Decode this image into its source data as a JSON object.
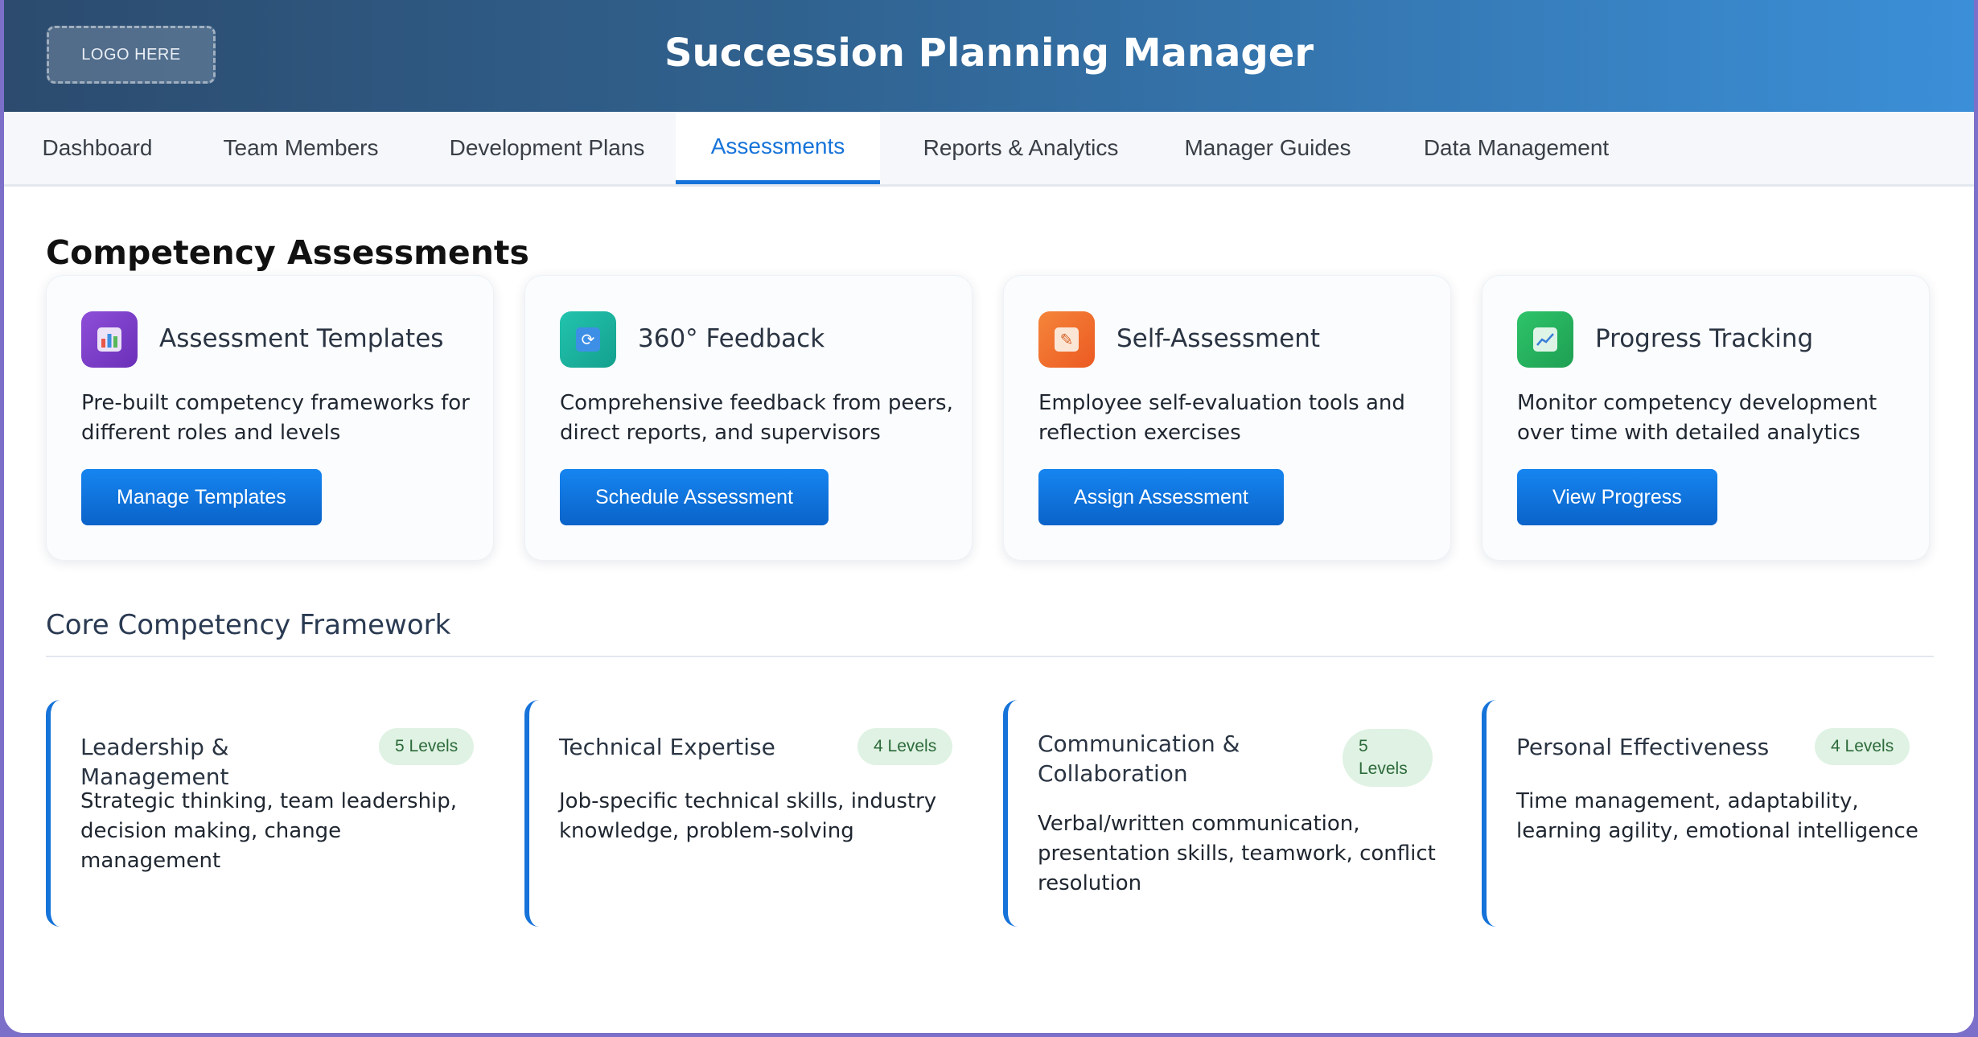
{
  "header": {
    "logo_text": "LOGO HERE",
    "title": "Succession Planning Manager"
  },
  "nav": {
    "tabs": [
      {
        "label": "Dashboard",
        "active": false
      },
      {
        "label": "Team Members",
        "active": false
      },
      {
        "label": "Development Plans",
        "active": false
      },
      {
        "label": "Assessments",
        "active": true
      },
      {
        "label": "Reports & Analytics",
        "active": false
      },
      {
        "label": "Manager Guides",
        "active": false
      },
      {
        "label": "Data Management",
        "active": false
      }
    ]
  },
  "main": {
    "title": "Competency Assessments",
    "cards": [
      {
        "icon": "bar-chart-icon",
        "icon_color": "#7b3fc4",
        "title": "Assessment Templates",
        "description": "Pre-built competency frameworks for different roles and levels",
        "button": "Manage Templates"
      },
      {
        "icon": "refresh-icon",
        "icon_color": "#1bb3a0",
        "title": "360° Feedback",
        "description": "Comprehensive feedback from peers, direct reports, and supervisors",
        "button": "Schedule Assessment"
      },
      {
        "icon": "memo-icon",
        "icon_color": "#f26b2a",
        "title": "Self-Assessment",
        "description": "Employee self-evaluation tools and reflection exercises",
        "button": "Assign Assessment"
      },
      {
        "icon": "trend-chart-icon",
        "icon_color": "#24b35c",
        "title": "Progress Tracking",
        "description": "Monitor competency development over time with detailed analytics",
        "button": "View Progress"
      }
    ],
    "framework": {
      "title": "Core Competency Framework",
      "items": [
        {
          "title": "Leadership & Management",
          "badge": "5 Levels",
          "description": "Strategic thinking, team leadership, decision making, change management"
        },
        {
          "title": "Technical Expertise",
          "badge": "4 Levels",
          "description": "Job-specific technical skills, industry knowledge, problem-solving"
        },
        {
          "title": "Communication & Collaboration",
          "badge": "5 Levels",
          "description": "Verbal/written communication, presentation skills, teamwork, conflict resolution"
        },
        {
          "title": "Personal Effectiveness",
          "badge": "4 Levels",
          "description": "Time management, adaptability, learning agility, emotional intelligence"
        }
      ]
    }
  },
  "colors": {
    "accent": "#1673d9",
    "badge_bg": "#dff2e3",
    "badge_text": "#2d6a3a"
  }
}
